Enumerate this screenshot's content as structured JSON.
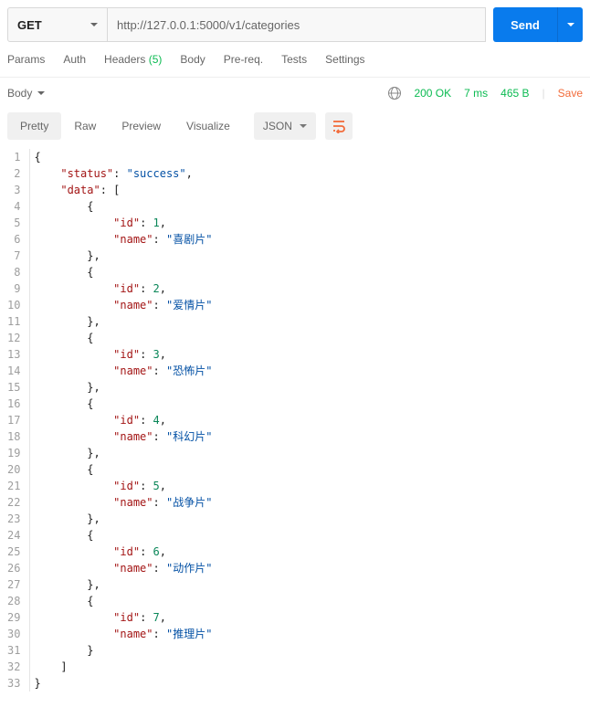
{
  "request": {
    "method": "GET",
    "url": "http://127.0.0.1:5000/v1/categories",
    "send_label": "Send"
  },
  "tabs": {
    "params": "Params",
    "auth": "Auth",
    "headers": "Headers",
    "headers_count": "(5)",
    "body": "Body",
    "prereq": "Pre-req.",
    "tests": "Tests",
    "settings": "Settings"
  },
  "response": {
    "which": "Body",
    "status": "200 OK",
    "time": "7 ms",
    "size": "465 B",
    "save": "Save"
  },
  "view": {
    "pretty": "Pretty",
    "raw": "Raw",
    "preview": "Preview",
    "visualize": "Visualize",
    "format": "JSON"
  },
  "json_body": {
    "status": "success",
    "data": [
      {
        "id": 1,
        "name": "喜剧片"
      },
      {
        "id": 2,
        "name": "爱情片"
      },
      {
        "id": 3,
        "name": "恐怖片"
      },
      {
        "id": 4,
        "name": "科幻片"
      },
      {
        "id": 5,
        "name": "战争片"
      },
      {
        "id": 6,
        "name": "动作片"
      },
      {
        "id": 7,
        "name": "推理片"
      }
    ]
  }
}
